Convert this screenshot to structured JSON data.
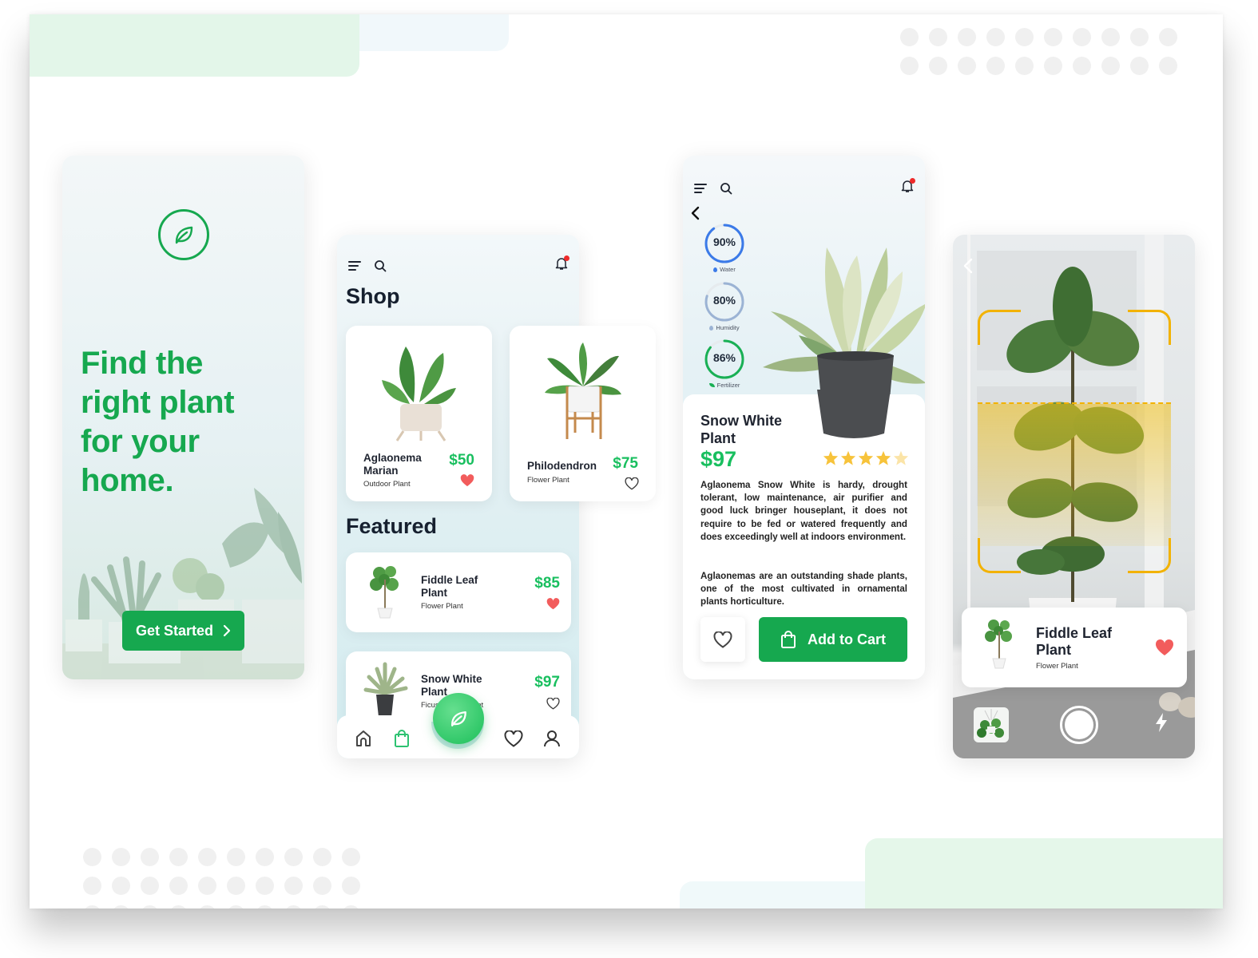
{
  "colors": {
    "brand_green": "#16a84f",
    "price_green": "#19bf5f",
    "heart_red": "#f25c5c",
    "notification_red": "#ee2a2a",
    "scan_yellow": "#f2b200",
    "water_blue": "#3b7ae8",
    "humidity_blue": "#9bb3d4",
    "fertilizer_green": "#19b055",
    "star_yellow": "#f7c33b"
  },
  "onboarding": {
    "logo_icon": "leaf-icon",
    "headline": "Find the\nright plant\nfor your\nhome.",
    "cta_label": "Get Started",
    "cta_icon": "chevron-right-icon"
  },
  "shop": {
    "title": "Shop",
    "featured_title": "Featured",
    "header_icons": [
      "menu-icon",
      "search-icon",
      "bell-icon"
    ],
    "cards": [
      {
        "name": "Aglaonema\nMarian",
        "type": "Outdoor Plant",
        "price": "$50",
        "favorited": true
      },
      {
        "name": "Philodendron",
        "type": "Flower Plant",
        "price": "$75",
        "favorited": false
      }
    ],
    "featured": [
      {
        "name": "Fiddle Leaf\nPlant",
        "type": "Flower Plant",
        "price": "$85",
        "favorited": true
      },
      {
        "name": "Snow White\nPlant",
        "type": "Ficus Flower Plant",
        "price": "$97",
        "favorited": false
      }
    ],
    "bottom_nav": [
      {
        "icon": "home-icon",
        "active": false
      },
      {
        "icon": "shopping-bag-icon",
        "active": true
      },
      {
        "icon": "leaf-icon",
        "active": false,
        "primary": true
      },
      {
        "icon": "heart-icon",
        "active": false
      },
      {
        "icon": "user-icon",
        "active": false
      }
    ]
  },
  "detail": {
    "header_icons": [
      "menu-icon",
      "search-icon",
      "bell-icon"
    ],
    "back_icon": "chevron-left-icon",
    "stats": [
      {
        "value": "90%",
        "percent": 90,
        "label": "Water",
        "icon": "water-drop-icon"
      },
      {
        "value": "80%",
        "percent": 80,
        "label": "Humidity",
        "icon": "water-drop-icon"
      },
      {
        "value": "86%",
        "percent": 86,
        "label": "Fertilizer",
        "icon": "leaf-icon"
      }
    ],
    "name": "Snow White\nPlant",
    "price": "$97",
    "rating": 4.5,
    "rating_max": 5,
    "description": [
      "Aglaonema Snow White is hardy, drought tolerant, low maintenance, air purifier and good luck bringer houseplant, it does not require to be fed or watered frequently and does exceedingly well at indoors environment.",
      "Aglaonemas are an outstanding shade plants, one of the most cultivated in ornamental plants horticulture."
    ],
    "favorite_icon": "heart-icon",
    "cart_label": "Add to Cart",
    "cart_icon": "shopping-bag-icon"
  },
  "scanner": {
    "back_icon": "chevron-left-icon",
    "result": {
      "name": "Fiddle Leaf\nPlant",
      "type": "Flower Plant",
      "favorited": true
    },
    "controls": [
      "gallery-thumbnail",
      "shutter-button",
      "flash-icon"
    ]
  }
}
